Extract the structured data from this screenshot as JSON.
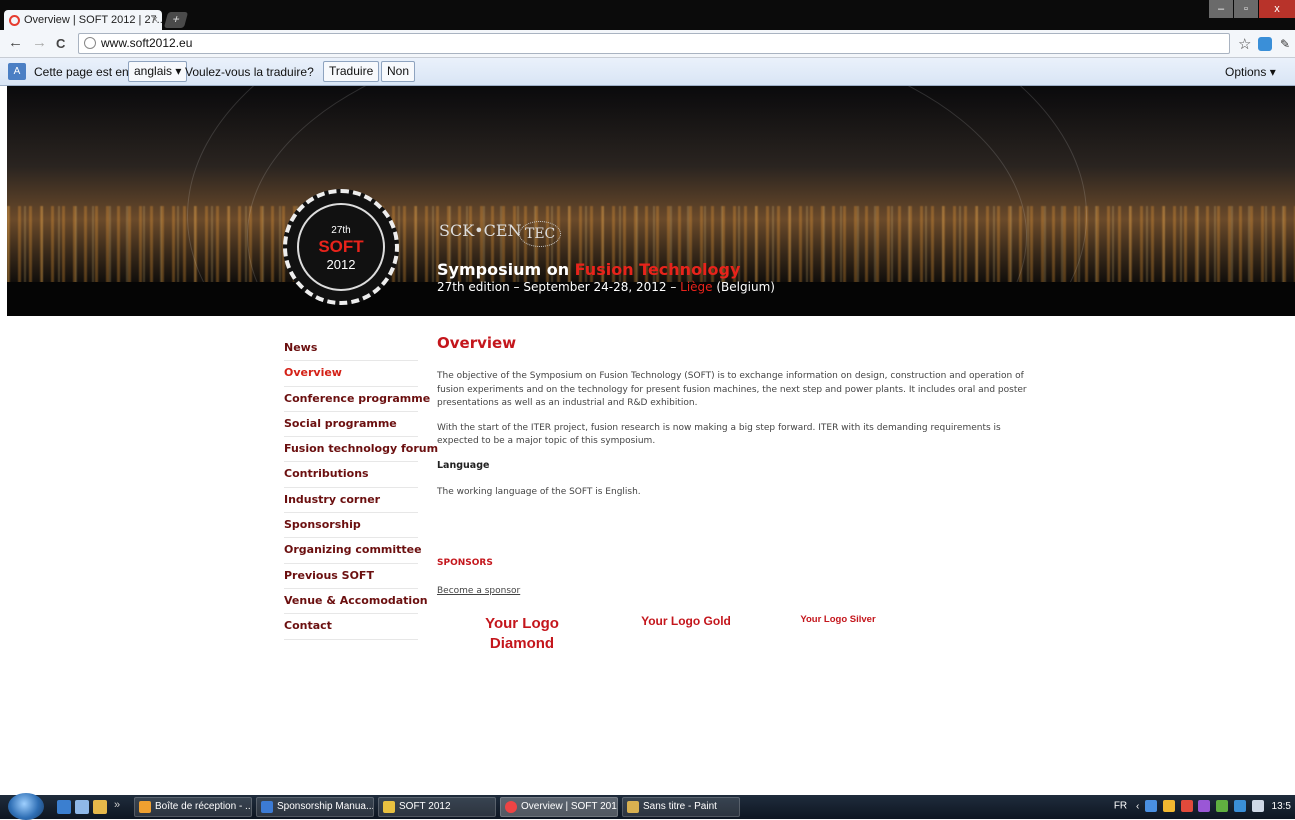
{
  "browser": {
    "tab_title": "Overview | SOFT 2012 | 27...",
    "tab_close": "×",
    "new_tab": "+",
    "url": "www.soft2012.eu",
    "back": "←",
    "forward": "→",
    "reload": "C",
    "star": "☆"
  },
  "translate_bar": {
    "prefix": "Cette page est en",
    "language": "anglais",
    "question": "Voulez-vous la traduire?",
    "translate_button": "Traduire",
    "no_button": "Non",
    "options": "Options"
  },
  "banner": {
    "logo_edition": "27th",
    "logo_name": "SOFT",
    "logo_year": "2012",
    "partner1": "SCK•CEN",
    "partner2": "TEC",
    "title_part1": "Symposium on ",
    "title_part2": "Fusion Technology",
    "subtitle_part1": "27th edition – September 24-28, 2012 – ",
    "subtitle_city": "Liège",
    "subtitle_part2": " (Belgium)"
  },
  "sidebar": {
    "items": [
      {
        "label": "News"
      },
      {
        "label": "Overview"
      },
      {
        "label": "Conference programme"
      },
      {
        "label": "Social programme"
      },
      {
        "label": "Fusion technology forum"
      },
      {
        "label": "Contributions"
      },
      {
        "label": "Industry corner"
      },
      {
        "label": "Sponsorship"
      },
      {
        "label": "Organizing committee"
      },
      {
        "label": "Previous SOFT"
      },
      {
        "label": "Venue & Accomodation"
      },
      {
        "label": "Contact"
      }
    ],
    "active": "Overview"
  },
  "main": {
    "title": "Overview",
    "para1": "The objective of the Symposium on Fusion Technology (SOFT) is to exchange information on design, construction and operation of fusion experiments and on the technology for present fusion machines, the next step and power plants. It includes oral and poster presentations as well as an industrial and R&D exhibition.",
    "para2": "With the start of the ITER project, fusion research is now making a big step forward. ITER with its demanding requirements is expected to be a major topic of this symposium.",
    "language_heading": "Language",
    "language_text": "The working language of the SOFT is English."
  },
  "sponsors": {
    "heading": "SPONSORS",
    "become_link": "Become a sponsor",
    "diamond": "Your Logo Diamond",
    "gold": "Your Logo Gold",
    "silver": "Your Logo Silver"
  },
  "taskbar": {
    "buttons": [
      {
        "label": "Boîte de réception - ..."
      },
      {
        "label": "Sponsorship Manua..."
      },
      {
        "label": "SOFT 2012"
      },
      {
        "label": "Overview | SOFT 201..."
      },
      {
        "label": "Sans titre - Paint"
      }
    ],
    "locale": "FR",
    "time": "13:5"
  },
  "colors": {
    "accent": "#c4161c",
    "nav_text": "#6b0f0f"
  }
}
